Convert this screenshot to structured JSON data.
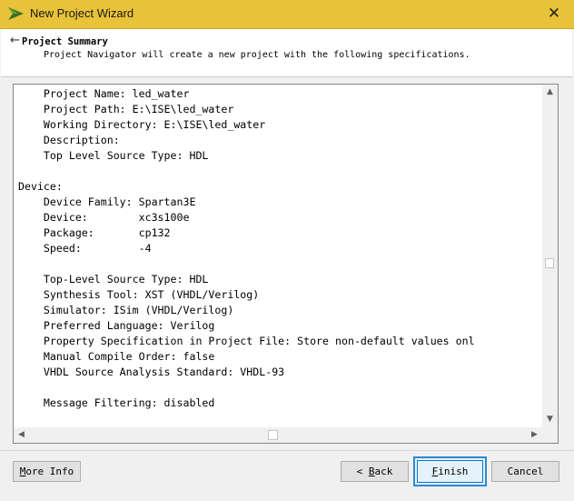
{
  "window": {
    "title": "New Project Wizard",
    "close_glyph": "✕",
    "titlebar_color": "#e8c238"
  },
  "header": {
    "back_glyph": "←",
    "title": "Project Summary",
    "subtitle": "Project Navigator will create a new project with the following specifications."
  },
  "summary": {
    "lines": [
      "    Project Name: led_water",
      "    Project Path: E:\\ISE\\led_water",
      "    Working Directory: E:\\ISE\\led_water",
      "    Description:",
      "    Top Level Source Type: HDL",
      "",
      "Device:",
      "    Device Family: Spartan3E",
      "    Device:        xc3s100e",
      "    Package:       cp132",
      "    Speed:         -4",
      "",
      "    Top-Level Source Type: HDL",
      "    Synthesis Tool: XST (VHDL/Verilog)",
      "    Simulator: ISim (VHDL/Verilog)",
      "    Preferred Language: Verilog",
      "    Property Specification in Project File: Store non-default values onl",
      "    Manual Compile Order: false",
      "    VHDL Source Analysis Standard: VHDL-93",
      "",
      "    Message Filtering: disabled"
    ]
  },
  "scrollbars": {
    "up": "▲",
    "down": "▼",
    "left": "◀",
    "right": "▶"
  },
  "buttons": {
    "more_info": {
      "accel": "M",
      "rest": "ore Info"
    },
    "back": {
      "prefix": "< ",
      "accel": "B",
      "rest": "ack"
    },
    "finish": {
      "accel": "F",
      "rest": "inish"
    },
    "cancel": "Cancel"
  },
  "icons": {
    "app": "ise-logo-icon",
    "close": "close-icon",
    "back": "back-arrow-icon"
  }
}
